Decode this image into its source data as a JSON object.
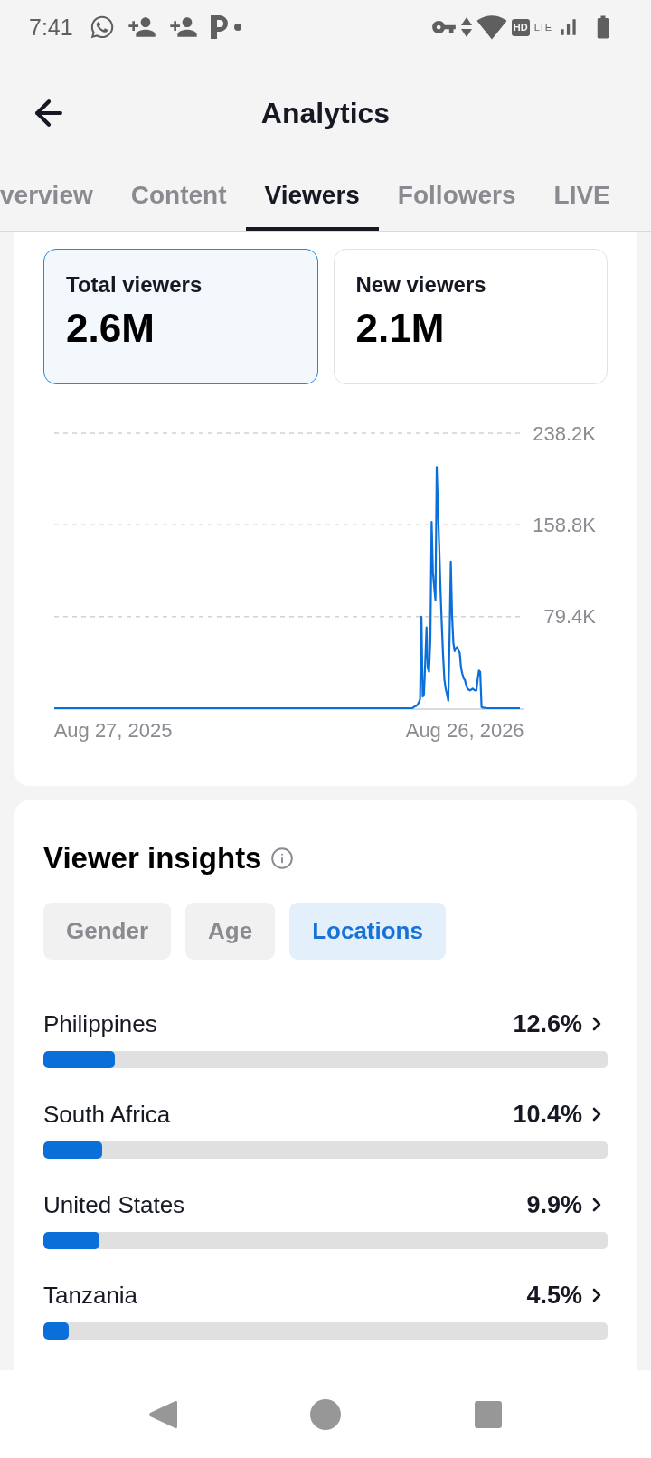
{
  "status_bar": {
    "time": "7:41",
    "network_badges": [
      {
        "label": "HD",
        "kind": "badge"
      },
      {
        "label": "LTE",
        "kind": "plain"
      }
    ]
  },
  "header": {
    "title": "Analytics"
  },
  "tabs": [
    {
      "label": "verview",
      "selected": false
    },
    {
      "label": "Content",
      "selected": false
    },
    {
      "label": "Viewers",
      "selected": true
    },
    {
      "label": "Followers",
      "selected": false
    },
    {
      "label": "LIVE",
      "selected": false
    }
  ],
  "summary": {
    "metrics": [
      {
        "label": "Total viewers",
        "value": "2.6M",
        "selected": true
      },
      {
        "label": "New viewers",
        "value": "2.1M",
        "selected": false
      }
    ],
    "chart_data": {
      "type": "line",
      "categories": [
        null,
        null,
        null,
        null,
        null,
        null,
        null,
        null,
        null,
        null,
        null,
        null,
        null,
        null,
        null,
        null,
        null,
        null,
        null,
        null,
        null,
        null,
        null,
        null,
        null,
        null,
        null,
        null,
        null,
        null,
        null,
        null,
        null,
        null,
        null,
        null,
        null,
        null,
        null,
        null,
        null,
        null,
        null,
        null,
        null,
        null,
        "Aug 27, 2025",
        null,
        null,
        null,
        null,
        null,
        null,
        null,
        null,
        null,
        null,
        null,
        null,
        null,
        null,
        null,
        null,
        null,
        null,
        null,
        null,
        null,
        null,
        null,
        null,
        null,
        null,
        null,
        null,
        null,
        null,
        null,
        null,
        null,
        null,
        null,
        null,
        null,
        null,
        null,
        null,
        null,
        null,
        null,
        null,
        null,
        null,
        null,
        null,
        null,
        null,
        null,
        null,
        null,
        null,
        null,
        null,
        null,
        null,
        null,
        null,
        null,
        null,
        null,
        null,
        null,
        null,
        null,
        null,
        null,
        null,
        null,
        null,
        null,
        null,
        null,
        null,
        null,
        null,
        null,
        null,
        null,
        null,
        null,
        null,
        null,
        null,
        null,
        null,
        null,
        null,
        null,
        null,
        null,
        null,
        null,
        null,
        null,
        null,
        null,
        null,
        null,
        null,
        null,
        null,
        null,
        null,
        null,
        null,
        null,
        null,
        null,
        null,
        null,
        null,
        null,
        null,
        null,
        null,
        null,
        null,
        null,
        null,
        null,
        null,
        null,
        null,
        null,
        null,
        null,
        null,
        null,
        null,
        null,
        null,
        null,
        null,
        null,
        null,
        null,
        null,
        null,
        null,
        null,
        null,
        null,
        null,
        null,
        null,
        null,
        null,
        null,
        null,
        null,
        null,
        null,
        null,
        null,
        null,
        null,
        null,
        null,
        null,
        null,
        null,
        null,
        null,
        null,
        null,
        null,
        null,
        null,
        null,
        null,
        null,
        null,
        null,
        null,
        null,
        null,
        null,
        null,
        null,
        null,
        null,
        null,
        null,
        null,
        null,
        null,
        null,
        null,
        null,
        null,
        null,
        null,
        null,
        null,
        null,
        null,
        null,
        null,
        null,
        null,
        null,
        null,
        null,
        null,
        null,
        null,
        null,
        null,
        null,
        null,
        null,
        null,
        null,
        null,
        null,
        null,
        null,
        null,
        null,
        null,
        null,
        null,
        null,
        null,
        null,
        null,
        null,
        null,
        null,
        null,
        null,
        null,
        null,
        null,
        null,
        null,
        null,
        null,
        null,
        null,
        null,
        null,
        null,
        null,
        null,
        null,
        null,
        null,
        null,
        null,
        null,
        null,
        null,
        null,
        null,
        null,
        null,
        null,
        null,
        null,
        null,
        null,
        null,
        null,
        null,
        null,
        null,
        null,
        null,
        null,
        null,
        "Aug 26, 2026",
        null,
        null,
        null,
        null,
        null,
        null,
        null,
        null,
        null,
        null,
        null,
        null,
        null,
        null,
        null,
        null,
        null,
        null,
        null,
        null,
        null,
        null,
        null,
        null,
        null,
        null,
        null,
        null,
        null,
        null,
        null,
        null,
        null,
        null,
        null,
        null,
        null,
        null,
        null,
        null,
        null,
        null,
        null
      ],
      "values": [
        0,
        0,
        0,
        0,
        0,
        0,
        0,
        0,
        0,
        0,
        0,
        0,
        0,
        0,
        0,
        0,
        0,
        0,
        0,
        0,
        0,
        0,
        0,
        0,
        0,
        0,
        0,
        0,
        0,
        0,
        0,
        0,
        0,
        0,
        0,
        0,
        0,
        0,
        0,
        0,
        0,
        0,
        0,
        0,
        0,
        0,
        0,
        0,
        0,
        0,
        0,
        0,
        0,
        0,
        0,
        0,
        0,
        0,
        0,
        0,
        0,
        0,
        0,
        0,
        0,
        0,
        0,
        0,
        0,
        0,
        0,
        0,
        0,
        0,
        0,
        0,
        0,
        0,
        0,
        0,
        0,
        0,
        0,
        0,
        0,
        0,
        0,
        0,
        0,
        0,
        0,
        0,
        0,
        0,
        0,
        0,
        0,
        0,
        0,
        0,
        0,
        0,
        0,
        0,
        0,
        0,
        0,
        0,
        0,
        0,
        0,
        0,
        0,
        0,
        0,
        0,
        0,
        0,
        0,
        0,
        0,
        0,
        0,
        0,
        0,
        0,
        0,
        0,
        0,
        0,
        0,
        0,
        0,
        0,
        0,
        0,
        0,
        0,
        0,
        0,
        0,
        0,
        0,
        0,
        0,
        0,
        0,
        0,
        0,
        0,
        0,
        0,
        0,
        0,
        0,
        0,
        0,
        0,
        0,
        0,
        0,
        0,
        0,
        0,
        0,
        0,
        0,
        0,
        0,
        0,
        0,
        0,
        0,
        0,
        0,
        0,
        0,
        0,
        0,
        0,
        0,
        0,
        0,
        0,
        0,
        0,
        0,
        0,
        0,
        0,
        0,
        0,
        0,
        0,
        0,
        0,
        0,
        0,
        0,
        0,
        0,
        0,
        0,
        0,
        0,
        0,
        0,
        0,
        0,
        0,
        0,
        0,
        0,
        0,
        0,
        0,
        0,
        0,
        0,
        0,
        0,
        0,
        0,
        0,
        0,
        0,
        0,
        0,
        0,
        0,
        0,
        0,
        0,
        0,
        0,
        0,
        0,
        0,
        0,
        0,
        0,
        0,
        0,
        0,
        0,
        0,
        0,
        0,
        0,
        0,
        0,
        0,
        0,
        0,
        0,
        0,
        0,
        0,
        0,
        0,
        0,
        0,
        0,
        0,
        0,
        0,
        0,
        0,
        0,
        0,
        0,
        0,
        0,
        0,
        0,
        0,
        0,
        0,
        0,
        0,
        0,
        1000,
        1500,
        2000,
        3000,
        5000,
        8000,
        79300,
        10000,
        12000,
        40000,
        70000,
        35000,
        31600,
        60000,
        161400,
        117600,
        105000,
        93600,
        209000,
        170000,
        137000,
        100000,
        71000,
        45000,
        25000,
        17000,
        12000,
        6500,
        60000,
        127000,
        80000,
        56700,
        49500,
        52000,
        53000,
        50000,
        47700,
        35000,
        30000,
        26000,
        24400,
        20000,
        17000,
        16000,
        15400,
        16000,
        17000,
        16000,
        15400,
        15400,
        25000,
        32600,
        31600,
        1000,
        500,
        300,
        200,
        0,
        0,
        0,
        0,
        0,
        0,
        0,
        0,
        0,
        0,
        0,
        0,
        0,
        0,
        0,
        0,
        0,
        0,
        0,
        0,
        0,
        0,
        0,
        0,
        0,
        0,
        0
      ],
      "ylim": [
        0,
        238200
      ],
      "yticks": [
        {
          "value": 79400,
          "label": "79.4K"
        },
        {
          "value": 158800,
          "label": "158.8K"
        },
        {
          "value": 238200,
          "label": "238.2K"
        }
      ]
    }
  },
  "viewer_insights": {
    "title": "Viewer insights",
    "filters": [
      {
        "label": "Gender",
        "selected": false
      },
      {
        "label": "Age",
        "selected": false
      },
      {
        "label": "Locations",
        "selected": true
      }
    ],
    "locations": [
      {
        "name": "Philippines",
        "share": "12.6%",
        "level": 0.126
      },
      {
        "name": "South Africa",
        "share": "10.4%",
        "level": 0.104
      },
      {
        "name": "United States",
        "share": "9.9%",
        "level": 0.099
      },
      {
        "name": "Tanzania",
        "share": "4.5%",
        "level": 0.045
      }
    ]
  }
}
